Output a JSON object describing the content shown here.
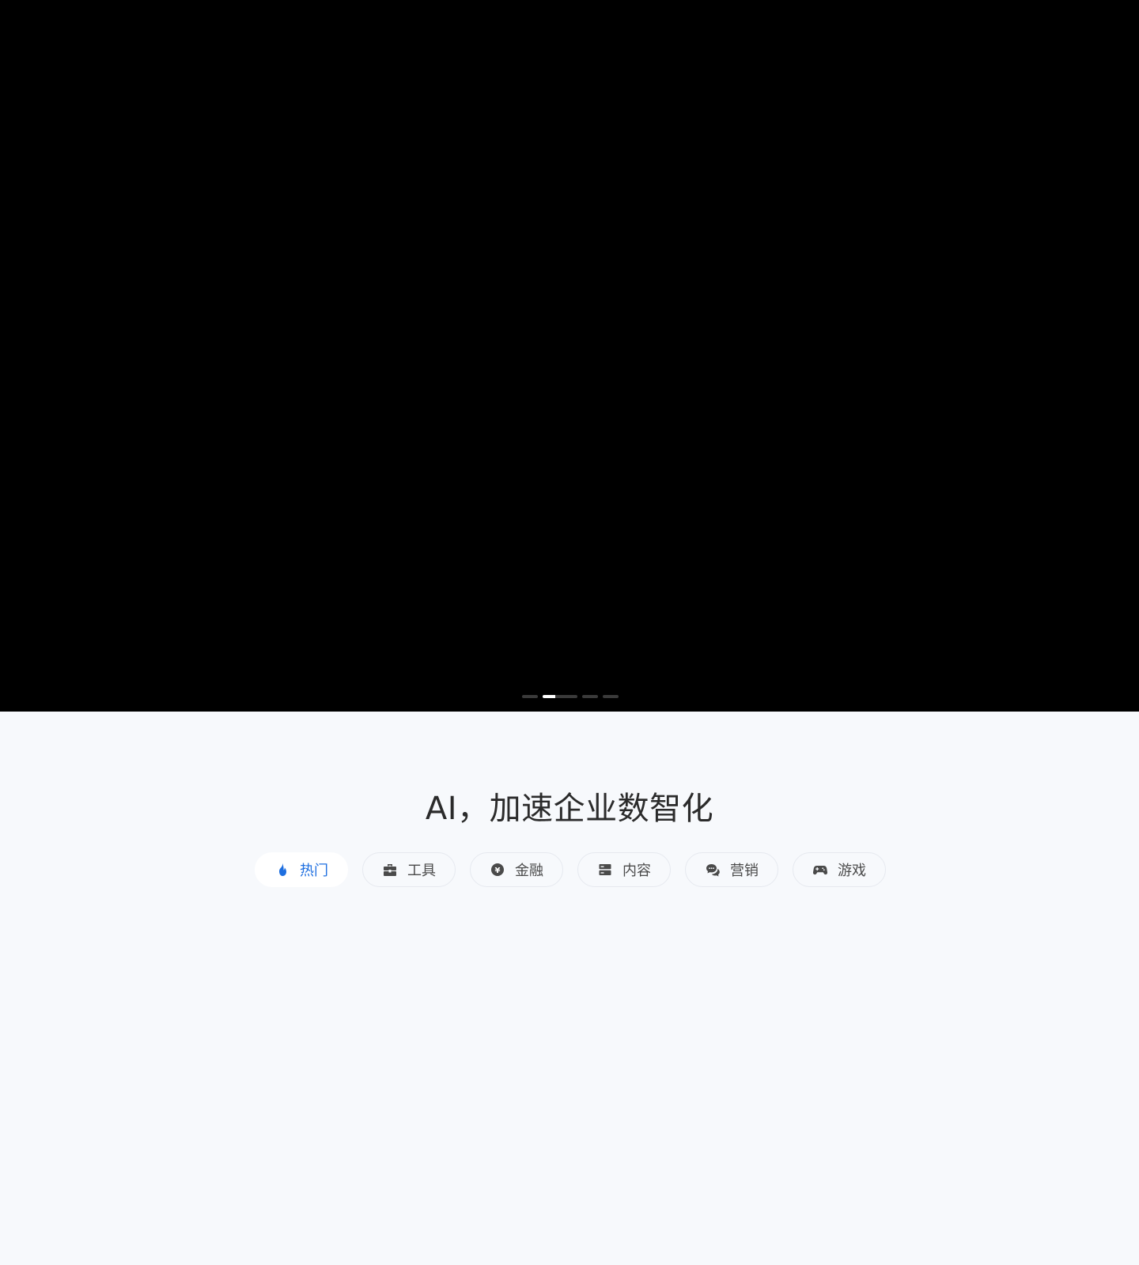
{
  "hero": {
    "carousel": {
      "slide_count": 5,
      "active_index": 1
    }
  },
  "section": {
    "title": "AI，加速企业数智化",
    "tabs": [
      {
        "label": "热门",
        "icon": "flame-icon",
        "active": true
      },
      {
        "label": "工具",
        "icon": "toolbox-icon",
        "active": false
      },
      {
        "label": "金融",
        "icon": "yen-coin-icon",
        "active": false
      },
      {
        "label": "内容",
        "icon": "server-icon",
        "active": false
      },
      {
        "label": "营销",
        "icon": "chat-bubbles-icon",
        "active": false
      },
      {
        "label": "游戏",
        "icon": "gamepad-icon",
        "active": false
      }
    ]
  },
  "colors": {
    "hero_background": "#000000",
    "page_background": "#f7f9fc",
    "accent": "#1e6fe0",
    "tab_text": "#4a4a4a",
    "title_text": "#2b2b2b"
  }
}
